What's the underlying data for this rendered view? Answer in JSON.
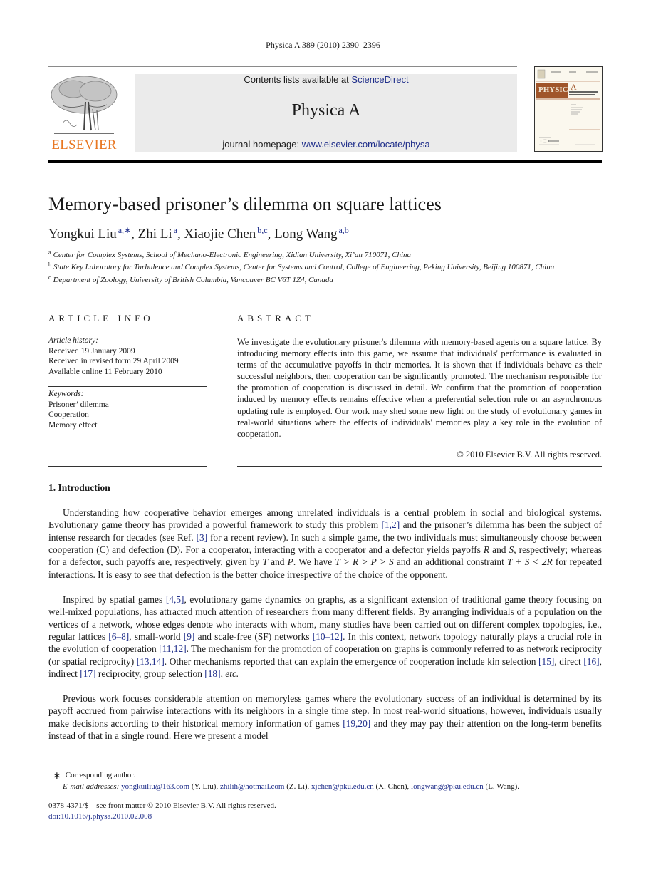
{
  "running_head": "Physica A 389 (2010) 2390–2396",
  "header": {
    "publisher_logo_text": "ELSEVIER",
    "publisher_logo_color": "#e87722",
    "contents_prefix": "Contents lists available at ",
    "contents_link": "ScienceDirect",
    "journal_name": "Physica A",
    "homepage_prefix": "journal homepage: ",
    "homepage_link": "www.elsevier.com/locate/physa",
    "banner_bg": "#ebebeb",
    "link_color": "#1f2e8a",
    "cover": {
      "title": "PHYSICA",
      "letter": "A",
      "subtitle_1": "STATISTICAL MECHANICS",
      "subtitle_2": "AND ITS APPLICATIONS",
      "band_color": "#a0552a"
    }
  },
  "article": {
    "title": "Memory-based prisoner’s dilemma on square lattices",
    "authors": [
      {
        "name": "Yongkui Liu",
        "sup": "a,∗"
      },
      {
        "name": "Zhi Li",
        "sup": "a"
      },
      {
        "name": "Xiaojie Chen",
        "sup": "b,c"
      },
      {
        "name": "Long Wang",
        "sup": "a,b"
      }
    ],
    "affiliations": [
      {
        "key": "a",
        "text": "Center for Complex Systems, School of Mechano-Electronic Engineering, Xidian University, Xi’an 710071, China"
      },
      {
        "key": "b",
        "text": "State Key Laboratory for Turbulence and Complex Systems, Center for Systems and Control, College of Engineering, Peking University, Beijing 100871, China"
      },
      {
        "key": "c",
        "text": "Department of Zoology, University of British Columbia, Vancouver BC V6T 1Z4, Canada"
      }
    ]
  },
  "article_info": {
    "heading": "ARTICLE INFO",
    "history_label": "Article history:",
    "history": [
      "Received 19 January 2009",
      "Received in revised form 29 April 2009",
      "Available online 11 February 2010"
    ],
    "keywords_label": "Keywords:",
    "keywords": [
      "Prisoner’ dilemma",
      "Cooperation",
      "Memory effect"
    ]
  },
  "abstract": {
    "heading": "ABSTRACT",
    "text": "We investigate the evolutionary prisoner's dilemma with memory-based agents on a square lattice. By introducing memory effects into this game, we assume that individuals' performance is evaluated in terms of the accumulative payoffs in their memories. It is shown that if individuals behave as their successful neighbors, then cooperation can be significantly promoted. The mechanism responsible for the promotion of cooperation is discussed in detail. We confirm that the promotion of cooperation induced by memory effects remains effective when a preferential selection rule or an asynchronous updating rule is employed. Our work may shed some new light on the study of evolutionary games in real-world situations where the effects of individuals' memories play a key role in the evolution of cooperation.",
    "copyright": "© 2010 Elsevier B.V. All rights reserved."
  },
  "introduction": {
    "heading": "1.  Introduction",
    "p1": [
      "Understanding how cooperative behavior emerges among unrelated individuals is a central problem in social and biological systems. Evolutionary game theory has provided a powerful framework to study this problem ",
      "[1,2]",
      " and the prisoner’s dilemma has been the subject of intense research for decades (see Ref. ",
      "[3]",
      " for a recent review). In such a simple game, the two individuals must simultaneously choose between cooperation (C) and defection (D). For a cooperator, interacting with a cooperator and a defector yields payoffs ",
      "R",
      " and ",
      "S",
      ", respectively; whereas for a defector, such payoffs are, respectively, given by ",
      "T",
      " and ",
      "P",
      ". We have ",
      "T > R > P > S",
      " and an additional constraint ",
      "T + S < 2R",
      " for repeated interactions. It is easy to see that defection is the better choice irrespective of the choice of the opponent."
    ],
    "p2": [
      "Inspired by spatial games ",
      "[4,5]",
      ", evolutionary game dynamics on graphs, as a significant extension of traditional game theory focusing on well-mixed populations, has attracted much attention of researchers from many different fields. By arranging individuals of a population on the vertices of a network, whose edges denote who interacts with whom, many studies have been carried out on different complex topologies, i.e., regular lattices ",
      "[6–8]",
      ", small-world ",
      "[9]",
      " and scale-free (SF) networks ",
      "[10–12]",
      ". In this context, network topology naturally plays a crucial role in the evolution of cooperation ",
      "[11,12]",
      ". The mechanism for the promotion of cooperation on graphs is commonly referred to as network reciprocity (or spatial reciprocity) ",
      "[13,14]",
      ". Other mechanisms reported that can explain the emergence of cooperation include kin selection ",
      "[15]",
      ", direct ",
      "[16]",
      ", indirect ",
      "[17]",
      " reciprocity, group selection ",
      "[18]",
      ", ",
      "etc."
    ],
    "p3": [
      "Previous work focuses considerable attention on memoryless games where the evolutionary success of an individual is determined by its payoff accrued from pairwise interactions with its neighbors in a single time step. In most real-world situations, however, individuals usually make decisions according to their historical memory information of games ",
      "[19,20]",
      " and they may pay their attention on the long-term benefits instead of that in a single round. Here we present a model"
    ]
  },
  "footnotes": {
    "star": "∗",
    "corresponding": "Corresponding author.",
    "email_label": "E-mail addresses:",
    "emails": [
      {
        "address": "yongkuiliu@163.com",
        "who": " (Y. Liu), "
      },
      {
        "address": "zhilih@hotmail.com",
        "who": " (Z. Li), "
      },
      {
        "address": "xjchen@pku.edu.cn",
        "who": " (X. Chen), "
      },
      {
        "address": "longwang@pku.edu.cn",
        "who": " (L. Wang)."
      }
    ],
    "front_matter": "0378-4371/$ – see front matter © 2010 Elsevier B.V. All rights reserved.",
    "doi": "doi:10.1016/j.physa.2010.02.008"
  }
}
